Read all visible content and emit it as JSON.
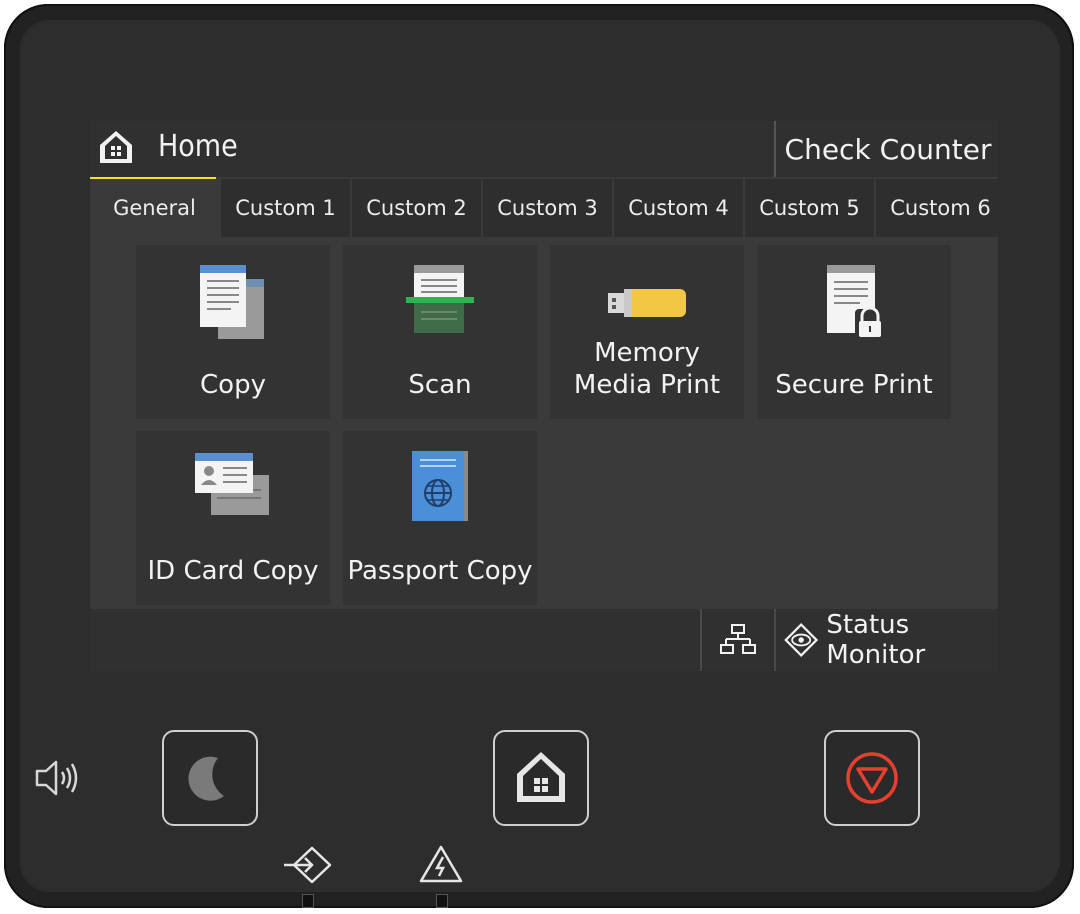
{
  "header": {
    "title": "Home",
    "check_counter": "Check Counter"
  },
  "tabs": [
    {
      "label": "General",
      "active": true
    },
    {
      "label": "Custom 1"
    },
    {
      "label": "Custom 2"
    },
    {
      "label": "Custom 3"
    },
    {
      "label": "Custom 4"
    },
    {
      "label": "Custom 5"
    },
    {
      "label": "Custom 6"
    }
  ],
  "apps": [
    {
      "label": "Copy",
      "icon": "copy-icon"
    },
    {
      "label": "Scan",
      "icon": "scan-icon"
    },
    {
      "label": "Memory\nMedia Print",
      "icon": "usb-memory-icon"
    },
    {
      "label": "Secure Print",
      "icon": "secure-print-icon"
    },
    {
      "label": "ID Card Copy",
      "icon": "id-card-icon"
    },
    {
      "label": "Passport Copy",
      "icon": "passport-icon"
    }
  ],
  "footer": {
    "status_monitor": "Status Monitor"
  },
  "colors": {
    "accent": "#f4df1d",
    "stop": "#e8402f",
    "usb": "#f2c744",
    "passport": "#4a8fd8"
  }
}
